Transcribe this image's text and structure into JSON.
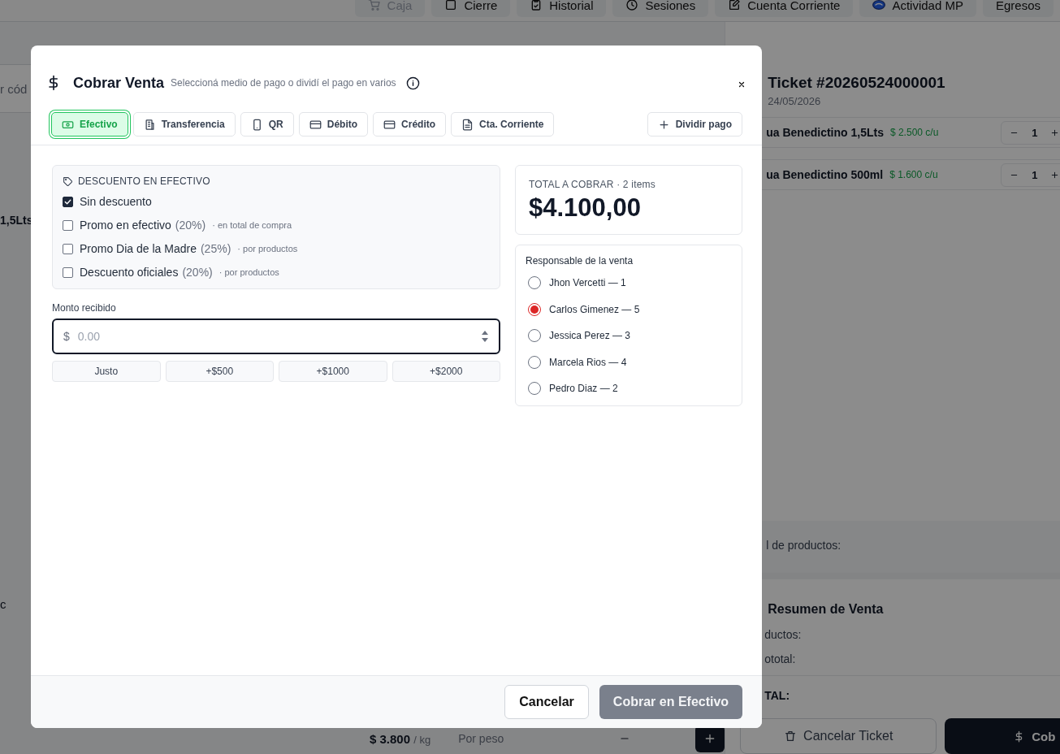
{
  "top_nav": [
    {
      "label": "Caja",
      "kind": "cart",
      "disabled": true
    },
    {
      "label": "Cierre",
      "kind": "square",
      "disabled": false
    },
    {
      "label": "Historial",
      "kind": "clipboard",
      "disabled": false
    },
    {
      "label": "Sesiones",
      "kind": "clock",
      "disabled": false
    },
    {
      "label": "Cuenta Corriente",
      "kind": "edit",
      "disabled": false
    },
    {
      "label": "Actividad MP",
      "kind": "logo",
      "disabled": false
    },
    {
      "label": "Egresos",
      "kind": "plain",
      "disabled": false
    }
  ],
  "catalog": {
    "search_fragment": "r cód",
    "product_fragment": "1,5Lts",
    "side_fragment": "c",
    "product_price": "$ 3.800",
    "product_unit": "/ kg",
    "product_mode": "Por peso"
  },
  "ticket": {
    "title": "Ticket #20260524000001",
    "date": "24/05/2026",
    "items": [
      {
        "name": "ua Benedictino 1,5Lts",
        "price": "$ 2.500 c/u",
        "quantity": "1"
      },
      {
        "name": "ua Benedictino 500ml",
        "price": "$ 1.600 c/u",
        "quantity": "1"
      }
    ],
    "products_label": "l de productos:",
    "summary_title": "Resumen de Venta",
    "summary_rows": [
      "ductos:",
      "ototal:"
    ],
    "total_label": "TAL:",
    "cancel_button": "Cancelar Ticket",
    "charge_button": "Cob"
  },
  "dialog": {
    "title": "Cobrar Venta",
    "subtitle": "Seleccioná medio de pago o dividí el pago en varios",
    "tabs": [
      {
        "label": "Efectivo",
        "kind": "cash",
        "selected": true
      },
      {
        "label": "Transferencia",
        "kind": "building",
        "selected": false
      },
      {
        "label": "QR",
        "kind": "phone",
        "selected": false
      },
      {
        "label": "Débito",
        "kind": "card",
        "selected": false
      },
      {
        "label": "Crédito",
        "kind": "card",
        "selected": false
      },
      {
        "label": "Cta. Corriente",
        "kind": "document",
        "selected": false
      }
    ],
    "split_button": "Dividir pago",
    "discount": {
      "title": "DESCUENTO EN EFECTIVO",
      "options": [
        {
          "label": "Sin descuento",
          "checked": true
        },
        {
          "label": "Promo en efectivo",
          "percent": "(20%)",
          "note": "· en total de compra",
          "checked": false
        },
        {
          "label": "Promo Dia de la Madre",
          "percent": "(25%)",
          "note": "· por productos",
          "checked": false
        },
        {
          "label": "Descuento oficiales",
          "percent": "(20%)",
          "note": "· por productos",
          "checked": false
        }
      ]
    },
    "amount": {
      "label": "Monto recibido",
      "currency": "$",
      "placeholder": "0.00",
      "quick_buttons": [
        "Justo",
        "+$500",
        "+$1000",
        "+$2000"
      ]
    },
    "total": {
      "label": "TOTAL A COBRAR · 2 items",
      "value": "$4.100,00"
    },
    "responsible": {
      "title": "Responsable de la venta",
      "people": [
        {
          "name": "Jhon Vercetti — 1",
          "selected": false
        },
        {
          "name": "Carlos Gimenez — 5",
          "selected": true
        },
        {
          "name": "Jessica Perez — 3",
          "selected": false
        },
        {
          "name": "Marcela Rios — 4",
          "selected": false
        },
        {
          "name": "Pedro Diaz — 2",
          "selected": false
        }
      ]
    },
    "cancel_button": "Cancelar",
    "confirm_button": {
      "label": "Cobrar en Efectivo",
      "disabled": true
    }
  }
}
